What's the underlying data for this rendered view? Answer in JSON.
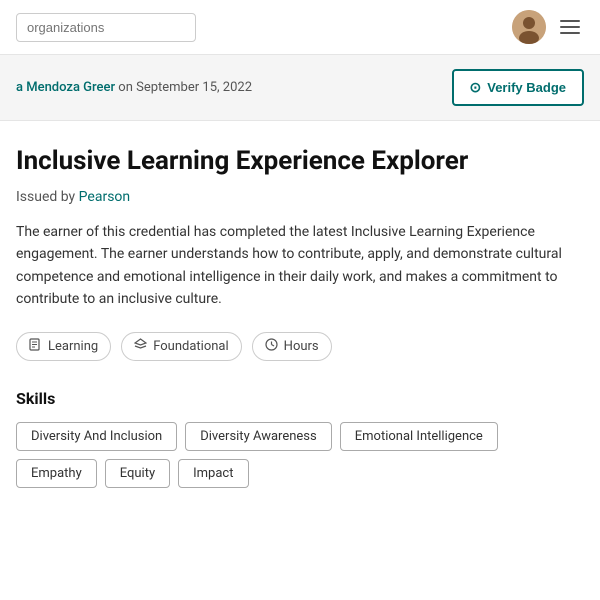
{
  "nav": {
    "search_placeholder": "organizations",
    "hamburger_label": "Menu"
  },
  "subtitle": {
    "author_name": "a Mendoza Greer",
    "date_text": "on September 15, 2022",
    "verify_button_label": "Verify Badge"
  },
  "badge": {
    "title": "Inclusive Learning Experience Explorer",
    "issued_by_label": "Issued by",
    "issuer": "Pearson",
    "description": "The earner of this credential has completed the latest Inclusive Learning Experience engagement. The earner understands how to contribute, apply, and demonstrate cultural competence and emotional intelligence in their daily work, and makes a commitment to contribute to an inclusive culture."
  },
  "tags": [
    {
      "icon": "📄",
      "label": "Learning"
    },
    {
      "icon": "🏅",
      "label": "Foundational"
    },
    {
      "icon": "🕐",
      "label": "Hours"
    }
  ],
  "skills": {
    "section_title": "Skills",
    "items": [
      "Diversity And Inclusion",
      "Diversity Awareness",
      "Emotional Intelligence",
      "Empathy",
      "Equity",
      "Impact"
    ]
  }
}
